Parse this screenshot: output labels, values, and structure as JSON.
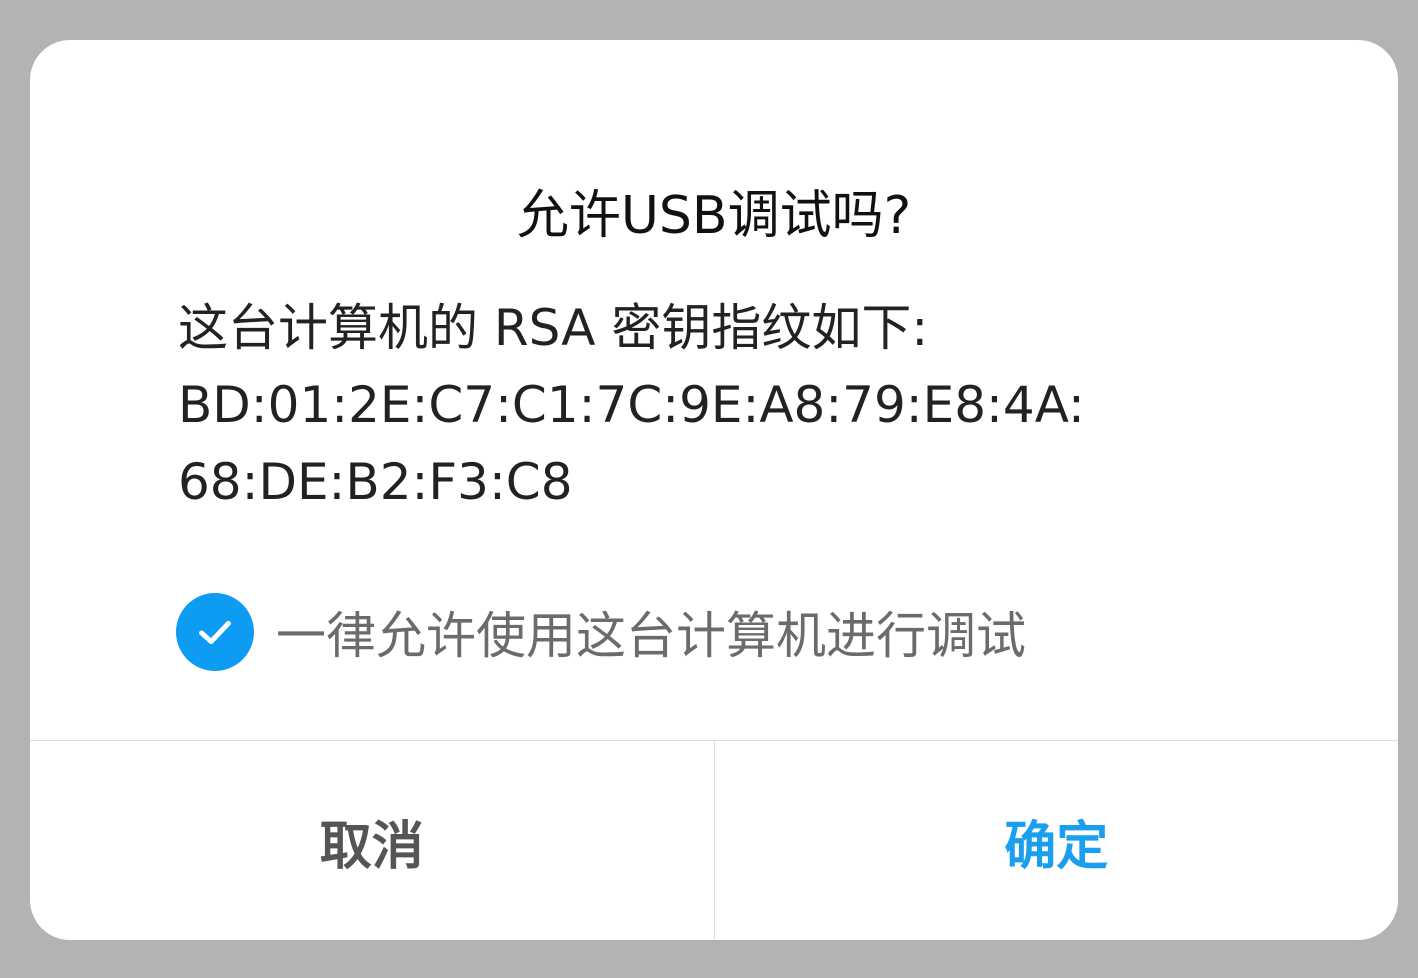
{
  "dialog": {
    "title": "允许USB调试吗?",
    "message_lines": [
      "这台计算机的 RSA 密钥指纹如下:",
      "BD:01:2E:C7:C1:7C:9E:A8:79:E8:4A:",
      "68:DE:B2:F3:C8"
    ],
    "always_allow": {
      "label": "一律允许使用这台计算机进行调试",
      "checked": true,
      "icon": "checkmark-icon"
    },
    "buttons": {
      "cancel_label": "取消",
      "ok_label": "确定"
    }
  },
  "colors": {
    "overlay": "#b3b3b3",
    "accent": "#1a9ef0",
    "checkbox": "#0d9bf3"
  }
}
